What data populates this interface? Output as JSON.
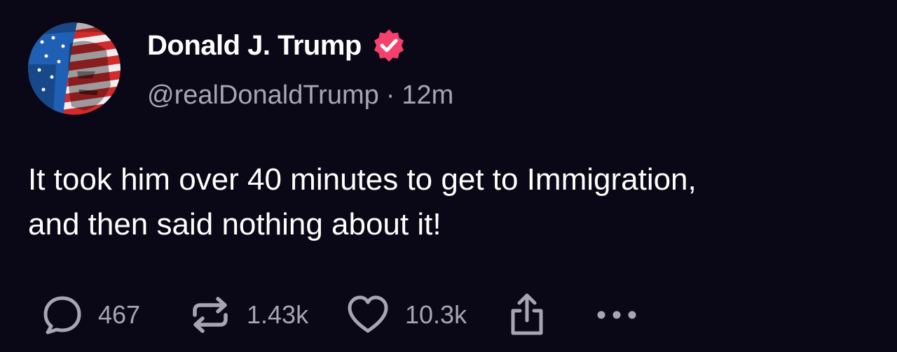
{
  "author": {
    "display_name": "Donald J. Trump",
    "handle": "@realDonaldTrump",
    "separator": "·",
    "time_ago": "12m",
    "verified": true,
    "verified_badge_color": "#f6416c"
  },
  "post": {
    "lines": [
      "It took him over 40 minutes to get to Immigration,",
      "and then said nothing about it!"
    ]
  },
  "actions": {
    "reply": {
      "icon": "reply-icon",
      "count": "467"
    },
    "retruth": {
      "icon": "retruth-icon",
      "count": "1.43k"
    },
    "like": {
      "icon": "heart-icon",
      "count": "10.3k"
    },
    "share": {
      "icon": "share-icon"
    },
    "more": {
      "icon": "more-icon"
    }
  },
  "colors": {
    "background": "#0a0816",
    "text_primary": "#ffffff",
    "text_secondary": "#a8a4b4",
    "accent": "#f6416c"
  }
}
